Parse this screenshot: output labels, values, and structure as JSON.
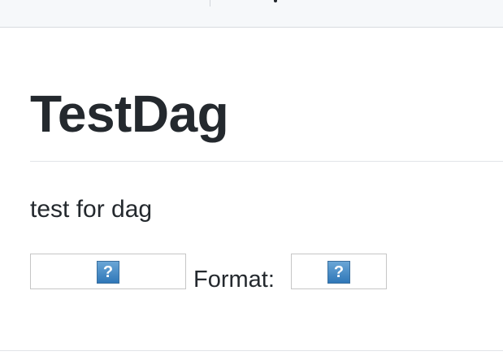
{
  "page": {
    "title": "TestDag",
    "description": "test for dag",
    "format_label": "Format:"
  },
  "images": [
    {
      "icon": "missing-image-icon",
      "glyph": "?"
    },
    {
      "icon": "missing-image-icon",
      "glyph": "?"
    }
  ],
  "colors": {
    "text": "#24292e",
    "topbar_background": "#f6f8fa",
    "rule": "#e1e4e8",
    "icon_fill": "#2f77b8"
  }
}
